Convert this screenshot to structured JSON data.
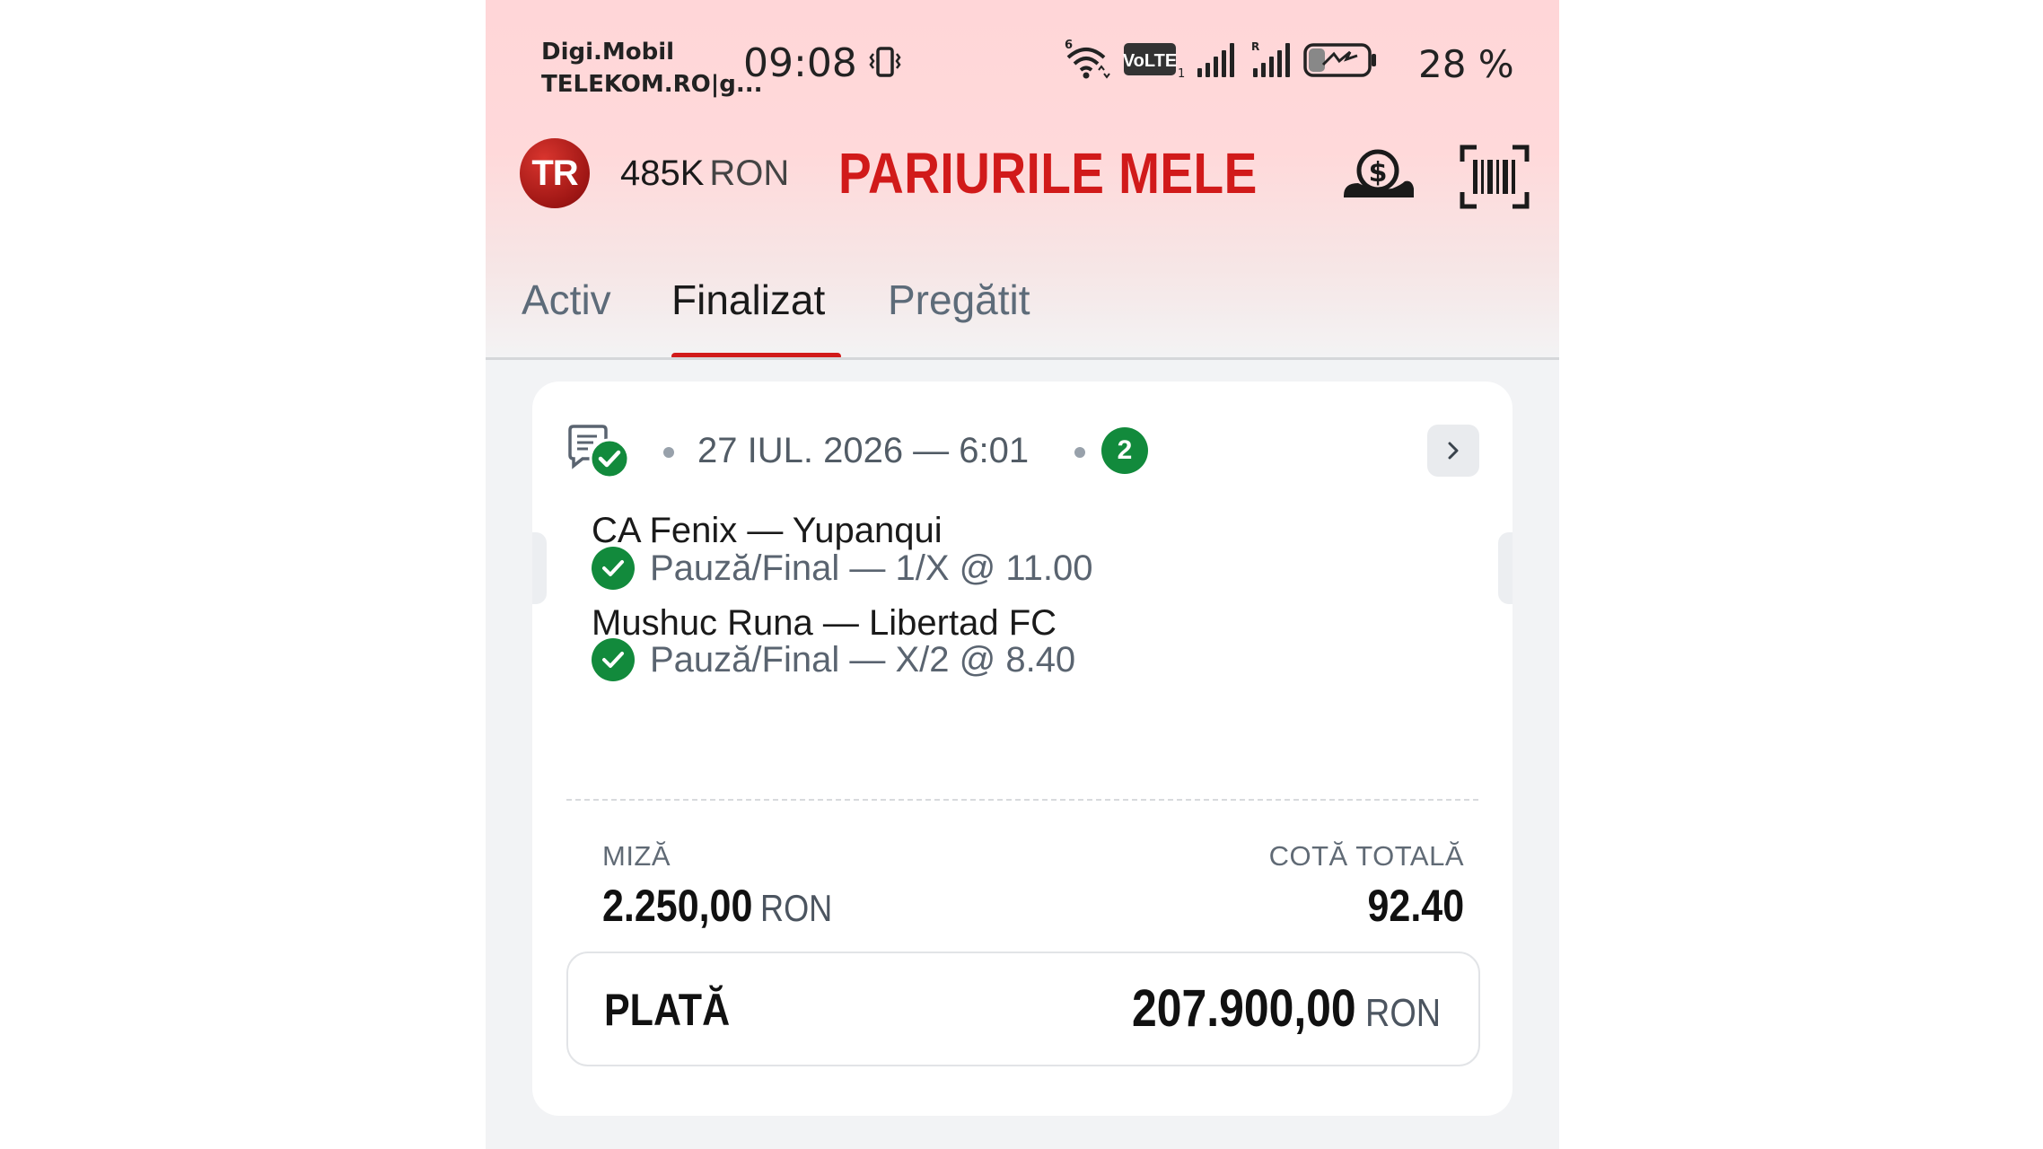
{
  "status_bar": {
    "carrier_1": "Digi.Mobil",
    "carrier_2": "TELEKOM.RO|g...",
    "time": "09:08",
    "volte_label": "VoLTE",
    "battery_percent": "28 %",
    "battery_level": 0.28,
    "icons": [
      "vibrate-icon",
      "wifi-icon",
      "volte-icon",
      "signal-icon",
      "signal-roaming-icon",
      "battery-charging-icon"
    ]
  },
  "header": {
    "avatar_initials": "TR",
    "balance_amount": "485K",
    "balance_currency": "RON",
    "title": "PARIURILE MELE",
    "icons": [
      "money-hand-icon",
      "barcode-scan-icon"
    ]
  },
  "tabs": [
    {
      "label": "Activ",
      "active": false
    },
    {
      "label": "Finalizat",
      "active": true
    },
    {
      "label": "Pregătit",
      "active": false
    }
  ],
  "ticket": {
    "date": "27 IUL. 2026 — 6:01",
    "selection_count": "2",
    "selections": [
      {
        "match": "CA Fenix — Yupanqui",
        "bet": "Pauză/Final — 1/X @ 11.00",
        "status": "won"
      },
      {
        "match": "Mushuc Runa — Libertad FC",
        "bet": "Pauză/Final — X/2 @ 8.40",
        "status": "won"
      }
    ],
    "stake_label": "MIZĂ",
    "stake_value": "2.250,00",
    "stake_currency": "RON",
    "total_odds_label": "COTĂ TOTALĂ",
    "total_odds_value": "92.40",
    "payout_label": "PLATĂ",
    "payout_value": "207.900,00",
    "payout_currency": "RON"
  },
  "colors": {
    "brand_red": "#d11a1a",
    "success_green": "#128a3c",
    "header_pink": "#ffd6d8"
  }
}
